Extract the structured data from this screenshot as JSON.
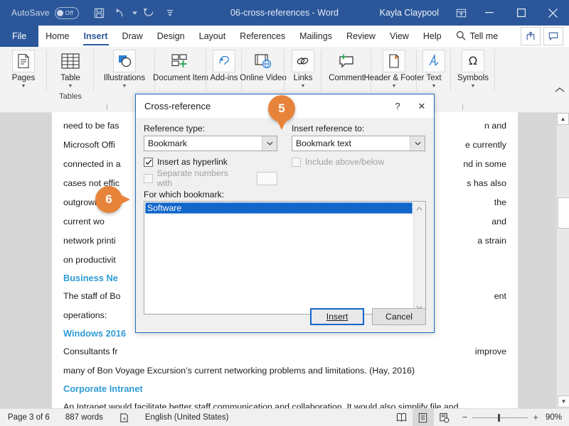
{
  "titlebar": {
    "autosave_label": "AutoSave",
    "autosave_state": "Off",
    "document_title": "06-cross-references - Word",
    "user_name": "Kayla Claypool",
    "quick_access": [
      {
        "name": "save-icon",
        "label": "Save"
      },
      {
        "name": "undo-icon",
        "label": "Undo"
      },
      {
        "name": "redo-icon",
        "label": "Redo"
      },
      {
        "name": "customize-qat-icon",
        "label": "Customize Quick Access Toolbar"
      }
    ],
    "window_buttons": [
      {
        "name": "ribbon-display-options-icon",
        "label": "Ribbon Display Options"
      },
      {
        "name": "minimize-icon",
        "label": "Minimize"
      },
      {
        "name": "maximize-icon",
        "label": "Maximize"
      },
      {
        "name": "close-icon",
        "label": "Close"
      }
    ]
  },
  "tabs": {
    "file_label": "File",
    "items": [
      {
        "label": "Home",
        "active": false
      },
      {
        "label": "Insert",
        "active": true
      },
      {
        "label": "Draw",
        "active": false
      },
      {
        "label": "Design",
        "active": false
      },
      {
        "label": "Layout",
        "active": false
      },
      {
        "label": "References",
        "active": false
      },
      {
        "label": "Mailings",
        "active": false
      },
      {
        "label": "Review",
        "active": false
      },
      {
        "label": "View",
        "active": false
      },
      {
        "label": "Help",
        "active": false
      }
    ],
    "tell_me_label": "Tell me",
    "share_label": "Share",
    "comments_label": "Comments"
  },
  "ribbon": {
    "groups": [
      {
        "group_label": "",
        "buttons": [
          {
            "label": "Pages",
            "icon": "pages-icon",
            "caret": true
          }
        ]
      },
      {
        "group_label": "Tables",
        "buttons": [
          {
            "label": "Table",
            "icon": "table-icon",
            "caret": true
          }
        ]
      },
      {
        "group_label": "",
        "buttons": [
          {
            "label": "Illustrations",
            "icon": "illustrations-icon",
            "caret": true
          }
        ]
      },
      {
        "group_label": "",
        "buttons": [
          {
            "label": "Document Item",
            "icon": "document-item-icon",
            "caret": false
          }
        ]
      },
      {
        "group_label": "",
        "buttons": [
          {
            "label": "Add-ins",
            "icon": "add-ins-icon",
            "caret": true
          }
        ]
      },
      {
        "group_label": "",
        "buttons": [
          {
            "label": "Online Video",
            "icon": "online-video-icon",
            "caret": false
          }
        ]
      },
      {
        "group_label": "",
        "buttons": [
          {
            "label": "Links",
            "icon": "links-icon",
            "caret": true
          }
        ]
      },
      {
        "group_label": "",
        "buttons": [
          {
            "label": "Comment",
            "icon": "comment-icon",
            "caret": false
          }
        ]
      },
      {
        "group_label": "",
        "buttons": [
          {
            "label": "Header & Footer",
            "icon": "header-footer-icon",
            "caret": true
          }
        ]
      },
      {
        "group_label": "",
        "buttons": [
          {
            "label": "Text",
            "icon": "text-icon",
            "caret": true
          }
        ]
      },
      {
        "group_label": "",
        "buttons": [
          {
            "label": "Symbols",
            "icon": "symbols-icon",
            "caret": true
          }
        ]
      }
    ]
  },
  "document": {
    "paragraph_1_lines": [
      "need to be fas",
      "Microsoft Offi",
      "connected in a",
      "cases not effic",
      "outgrown its s",
      "current wo",
      "network printi",
      "on productivit"
    ],
    "paragraph_1_right_lines": [
      "n and",
      "e currently",
      "nd in some",
      "s has also",
      "the",
      "and",
      "a strain"
    ],
    "heading_1": "Business Ne",
    "body_1_left": "The staff of Bo",
    "body_1_right": "ent",
    "body_1_line2": "operations:",
    "heading_2": "Windows 2016",
    "body_2_left": "Consultants fr",
    "body_2_right": "improve",
    "body_2_line2": "many of Bon Voyage Excursion’s current networking problems and limitations. (Hay, 2016)",
    "heading_3": "Corporate Intranet",
    "body_3": "An Intranet would facilitate better staff communication and collaboration. It would also simplify file and"
  },
  "dialog": {
    "title": "Cross-reference",
    "help_label": "?",
    "close_label": "✕",
    "reference_type_label": "Reference type:",
    "reference_type_value": "Bookmark",
    "insert_reference_to_label": "Insert reference to:",
    "insert_reference_to_value": "Bookmark text",
    "insert_as_hyperlink_label": "Insert as hyperlink",
    "insert_as_hyperlink_checked": true,
    "include_above_below_label": "Include above/below",
    "include_above_below_checked": false,
    "separate_numbers_with_label": "Separate numbers with",
    "separate_numbers_with_checked": false,
    "separate_numbers_value": "",
    "for_which_label": "For which bookmark:",
    "list_items": [
      "Software"
    ],
    "selected_item": "Software",
    "insert_button": "Insert",
    "cancel_button": "Cancel"
  },
  "callouts": [
    {
      "number": "5",
      "direction": "down"
    },
    {
      "number": "6",
      "direction": "right"
    }
  ],
  "statusbar": {
    "page_label": "Page 3 of 6",
    "word_count": "887 words",
    "proofing_icon": "proofing-errors-icon",
    "language": "English (United States)",
    "view_buttons": [
      {
        "name": "read-mode-icon",
        "label": "Read Mode",
        "active": false
      },
      {
        "name": "print-layout-icon",
        "label": "Print Layout",
        "active": true
      },
      {
        "name": "web-layout-icon",
        "label": "Web Layout",
        "active": false
      }
    ],
    "zoom_out": "−",
    "zoom_in": "+",
    "zoom_level": "90%"
  },
  "colors": {
    "word_blue": "#2b579a",
    "accent_orange": "#e8833a",
    "heading_blue": "#2e9bd6",
    "selection_blue": "#1266c9",
    "dialog_border": "#1f6bbf"
  }
}
